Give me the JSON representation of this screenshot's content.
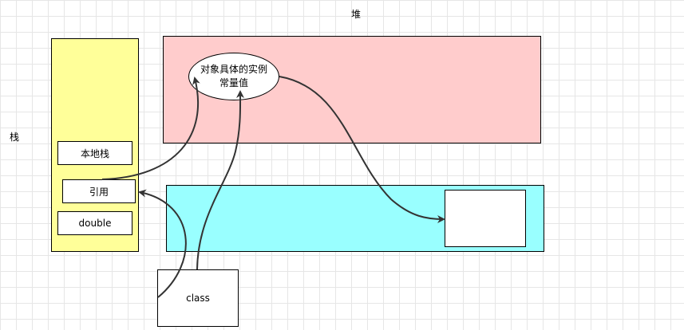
{
  "labels": {
    "heap": "堆",
    "stack": "栈"
  },
  "stack_items": {
    "native_stack": "本地栈",
    "reference": "引用",
    "double": "double"
  },
  "heap_object": {
    "line1": "对象具体的实例",
    "line2": "常量值"
  },
  "class_box": "class",
  "colors": {
    "stack_fill": "#ffff99",
    "heap_fill": "#ffcccc",
    "cyan_fill": "#99ffff",
    "stroke": "#000000",
    "arrow": "#333333"
  }
}
